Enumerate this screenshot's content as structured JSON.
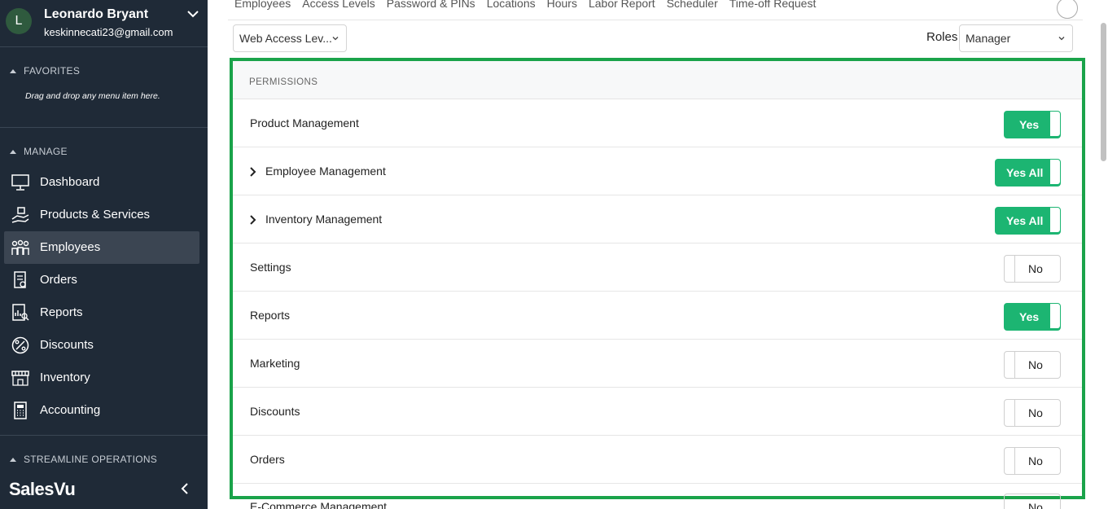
{
  "user": {
    "initial": "L",
    "name": "Leonardo Bryant",
    "email": "keskinnecati23@gmail.com"
  },
  "sidebar": {
    "favorites_header": "FAVORITES",
    "favorites_hint": "Drag and drop any menu item here.",
    "manage_header": "MANAGE",
    "items": [
      {
        "label": "Dashboard",
        "icon": "monitor-icon"
      },
      {
        "label": "Products & Services",
        "icon": "products-icon"
      },
      {
        "label": "Employees",
        "icon": "people-icon",
        "active": true
      },
      {
        "label": "Orders",
        "icon": "orders-icon"
      },
      {
        "label": "Reports",
        "icon": "report-icon"
      },
      {
        "label": "Discounts",
        "icon": "percent-icon"
      },
      {
        "label": "Inventory",
        "icon": "store-icon"
      },
      {
        "label": "Accounting",
        "icon": "calculator-icon"
      }
    ],
    "streamline_header": "STREAMLINE OPERATIONS",
    "brand": "SalesVu"
  },
  "tabs": [
    "Employees",
    "Access Levels",
    "Password & PINs",
    "Locations",
    "Hours",
    "Labor Report",
    "Scheduler",
    "Time-off Request"
  ],
  "filters": {
    "access_level": "Web Access Lev...",
    "roles_label": "Roles",
    "role": "Manager"
  },
  "permissions": {
    "header": "PERMISSIONS",
    "rows": [
      {
        "label": "Product Management",
        "value": "Yes",
        "expandable": false
      },
      {
        "label": "Employee Management",
        "value": "Yes All",
        "expandable": true
      },
      {
        "label": "Inventory Management",
        "value": "Yes All",
        "expandable": true
      },
      {
        "label": "Settings",
        "value": "No",
        "expandable": false
      },
      {
        "label": "Reports",
        "value": "Yes",
        "expandable": false
      },
      {
        "label": "Marketing",
        "value": "No",
        "expandable": false
      },
      {
        "label": "Discounts",
        "value": "No",
        "expandable": false
      },
      {
        "label": "Orders",
        "value": "No",
        "expandable": false
      }
    ],
    "partial_row": {
      "label": "E-Commerce Management",
      "value": "No"
    }
  },
  "colors": {
    "sidebar_bg": "#1f2a37",
    "accent_green": "#1cb572",
    "highlight_border": "#1aa34a"
  }
}
